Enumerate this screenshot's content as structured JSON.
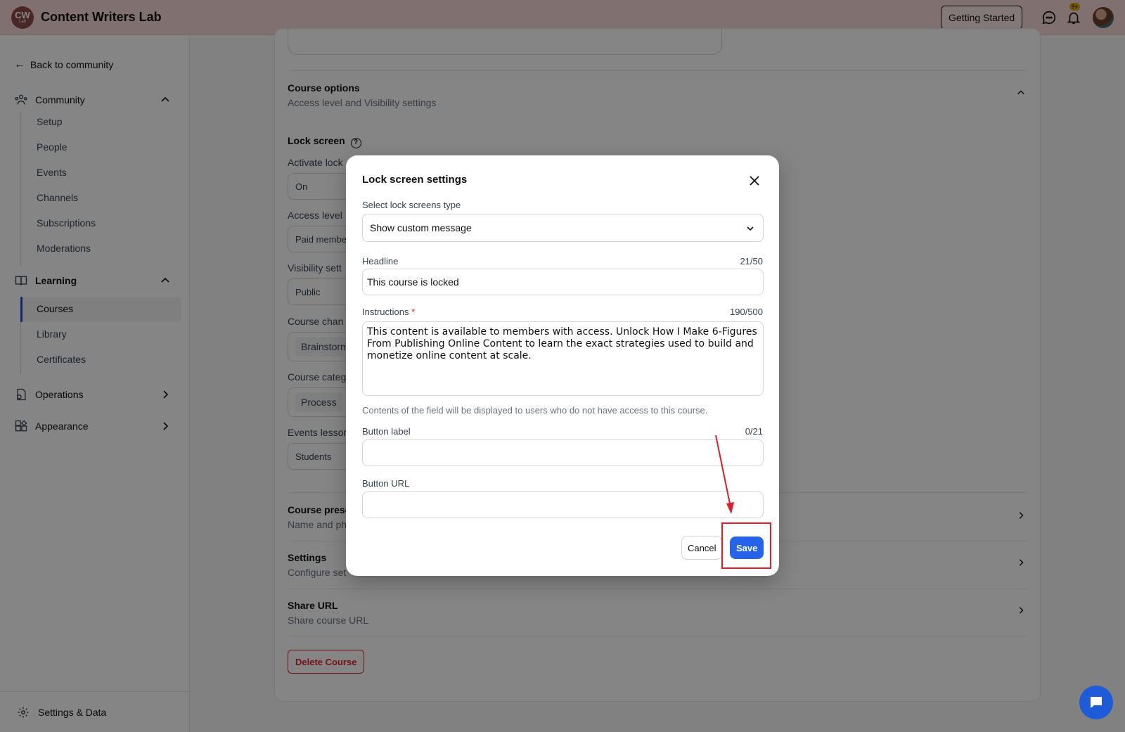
{
  "app": {
    "logo_text": "CW",
    "logo_sub": "Lab",
    "title": "Content Writers Lab"
  },
  "topbar": {
    "getting_started": "Getting Started",
    "notification_badge": "9+"
  },
  "sidebar": {
    "back": "Back to community",
    "community": {
      "label": "Community",
      "items": [
        "Setup",
        "People",
        "Events",
        "Channels",
        "Subscriptions",
        "Moderations"
      ]
    },
    "learning": {
      "label": "Learning",
      "items": [
        "Courses",
        "Library",
        "Certificates"
      ],
      "active": "Courses"
    },
    "operations": "Operations",
    "appearance": "Appearance",
    "settings_data": "Settings & Data"
  },
  "main": {
    "course_options": {
      "title": "Course options",
      "subtitle": "Access level and Visibility settings"
    },
    "lock_screen": "Lock screen",
    "fields": [
      {
        "label": "Activate lock",
        "value": "On"
      },
      {
        "label": "Access level",
        "value": "Paid membe"
      },
      {
        "label": "Visibility sett",
        "value": "Public"
      },
      {
        "label": "Course chan",
        "value": "Brainstorm"
      },
      {
        "label": "Course categ",
        "value": "Process"
      },
      {
        "label": "Events lessor",
        "value": "Students"
      }
    ],
    "sections": [
      {
        "title": "Course prese",
        "subtitle": "Name and ph"
      },
      {
        "title": "Settings",
        "subtitle": "Configure set"
      },
      {
        "title": "Share URL",
        "subtitle": "Share course URL"
      }
    ],
    "delete": "Delete Course"
  },
  "modal": {
    "title": "Lock screen settings",
    "type_label": "Select lock screens type",
    "type_value": "Show custom message",
    "headline_label": "Headline",
    "headline_count": "21/50",
    "headline_value": "This course is locked",
    "instructions_label": "Instructions",
    "instructions_required": "*",
    "instructions_count": "190/500",
    "instructions_value": "This content is available to members with access. Unlock How I Make 6-Figures From Publishing Online Content to learn the exact strategies used to build and monetize online content at scale.",
    "help_text": "Contents of the field will be displayed to users who do not have access to this course.",
    "button_label_label": "Button label",
    "button_label_count": "0/21",
    "button_label_value": "",
    "button_url_label": "Button URL",
    "button_url_value": "",
    "cancel": "Cancel",
    "save": "Save"
  },
  "colors": {
    "primary": "#2563eb",
    "annotation": "#e11d2a",
    "topbar": "#f6d9d7"
  }
}
